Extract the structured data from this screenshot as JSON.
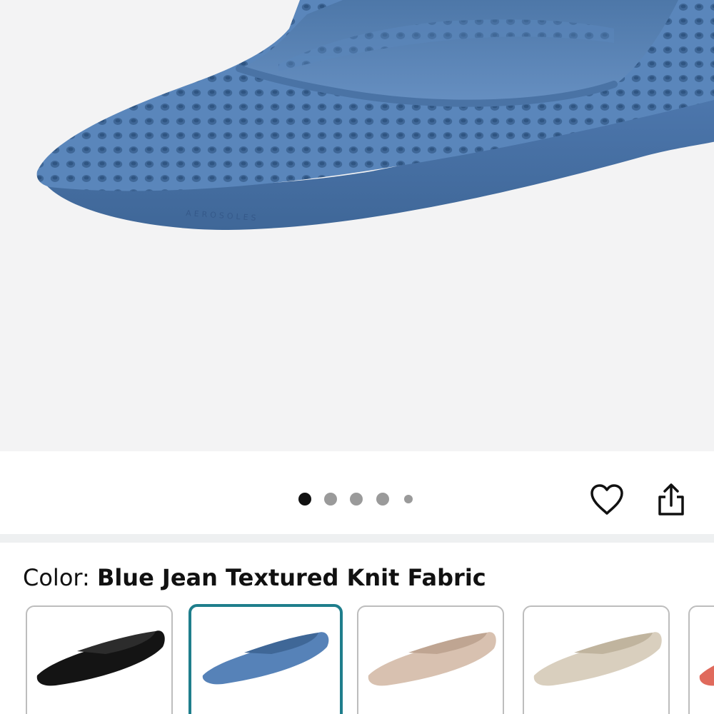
{
  "product": {
    "image_alt": "Blue knit pointed-toe ballet flat",
    "brand_mark": "AEROSOLES"
  },
  "carousel": {
    "total": 5,
    "active_index": 0
  },
  "actions": {
    "favorite_icon": "heart-icon",
    "share_icon": "share-icon"
  },
  "color": {
    "label": "Color:",
    "value": "Blue Jean Textured Knit Fabric"
  },
  "swatches": [
    {
      "color": "#141414",
      "selected": false
    },
    {
      "color": "#5682b8",
      "selected": true
    },
    {
      "color": "#d8c1b0",
      "selected": false
    },
    {
      "color": "#d9cfbe",
      "selected": false
    },
    {
      "color": "#e06a5c",
      "selected": false
    }
  ],
  "colors": {
    "selected_border": "#1f7e8c",
    "shoe_blue": "#5682b8"
  }
}
